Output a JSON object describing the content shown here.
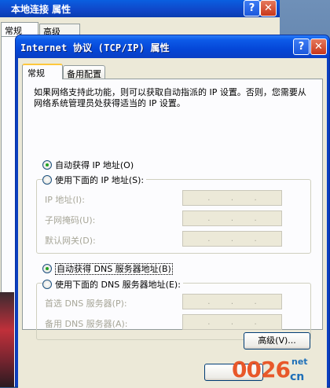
{
  "background_window": {
    "title": "本地连接 属性",
    "tabs": [
      "常规",
      "高级"
    ]
  },
  "dialog": {
    "title": "Internet 协议 (TCP/IP) 属性",
    "help_glyph": "?",
    "close_glyph": "✕",
    "tabs": [
      {
        "label": "常规",
        "selected": true
      },
      {
        "label": "备用配置",
        "selected": false
      }
    ],
    "intro": "如果网络支持此功能，则可以获取自动指派的 IP 设置。否则，您需要从网络系统管理员处获得适当的 IP 设置。",
    "ip_auto": {
      "label": "自动获得 IP 地址(O)",
      "checked": true
    },
    "ip_manual": {
      "label": "使用下面的 IP 地址(S):",
      "checked": false
    },
    "ip_fields": [
      {
        "label": "IP 地址(I):"
      },
      {
        "label": "子网掩码(U):"
      },
      {
        "label": "默认网关(D):"
      }
    ],
    "dns_auto": {
      "label": "自动获得 DNS 服务器地址(B)",
      "checked": true
    },
    "dns_manual": {
      "label": "使用下面的 DNS 服务器地址(E):",
      "checked": false
    },
    "dns_fields": [
      {
        "label": "首选 DNS 服务器(P):"
      },
      {
        "label": "备用 DNS 服务器(A):"
      }
    ],
    "advanced_button": "高级(V)..."
  },
  "watermark": {
    "digits": "0026",
    "suffix": "net",
    "cn": "cn"
  },
  "colors": {
    "titlebar": "#0547d8",
    "client": "#ece9d8",
    "panel": "#fcfcfe",
    "tab_accent": "#ffc83c",
    "radio_dot": "#21a121",
    "disabled_text": "#a7a698"
  }
}
